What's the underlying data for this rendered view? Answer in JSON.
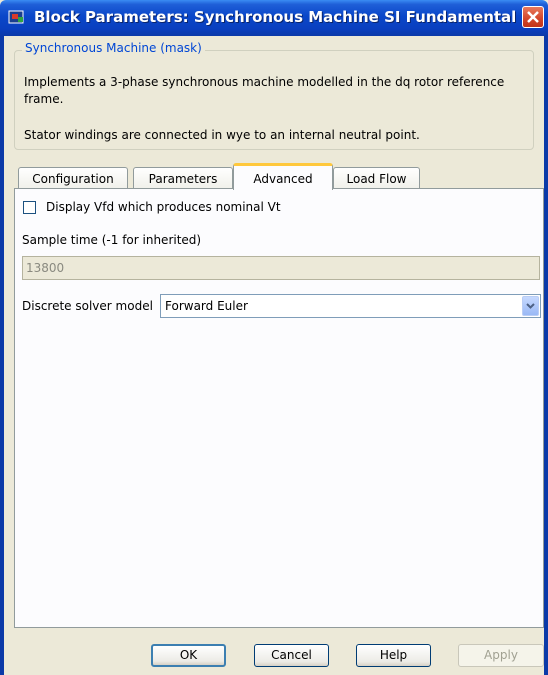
{
  "window": {
    "title": "Block Parameters: Synchronous Machine SI Fundamental"
  },
  "mask": {
    "legend": "Synchronous Machine (mask)",
    "description_line1": "Implements a 3-phase synchronous machine modelled in the dq rotor reference frame.",
    "description_line2": "Stator windings are connected in wye to an internal neutral point."
  },
  "tabs": [
    {
      "label": "Configuration"
    },
    {
      "label": "Parameters"
    },
    {
      "label": "Advanced",
      "active": true
    },
    {
      "label": "Load Flow"
    }
  ],
  "advanced": {
    "display_vfd_label": "Display Vfd which produces nominal Vt",
    "display_vfd_checked": false,
    "sample_time_label": "Sample time (-1 for inherited)",
    "sample_time_value": "13800",
    "solver_label": "Discrete solver model",
    "solver_value": "Forward Euler"
  },
  "buttons": {
    "ok": "OK",
    "cancel": "Cancel",
    "help": "Help",
    "apply": "Apply"
  },
  "colors": {
    "titlebar": "#0a47c9",
    "active_tab_accent": "#ffc83c",
    "mask_legend": "#0046d5",
    "close_button": "#d2452a"
  },
  "icons": [
    "simulink-block-icon",
    "close-icon",
    "chevron-down-icon"
  ]
}
